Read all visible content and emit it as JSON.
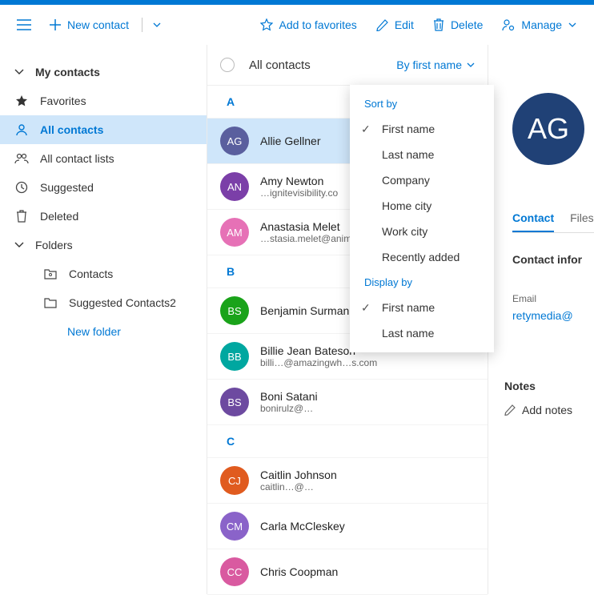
{
  "toolbar": {
    "new_contact": "New contact",
    "add_to_favorites": "Add to favorites",
    "edit": "Edit",
    "delete": "Delete",
    "manage": "Manage"
  },
  "sidebar": {
    "header": "My contacts",
    "items": [
      {
        "label": "Favorites",
        "icon": "star"
      },
      {
        "label": "All contacts",
        "icon": "person",
        "selected": true
      },
      {
        "label": "All contact lists",
        "icon": "group"
      },
      {
        "label": "Suggested",
        "icon": "clock"
      },
      {
        "label": "Deleted",
        "icon": "trash"
      }
    ],
    "folders_label": "Folders",
    "subfolders": [
      {
        "label": "Contacts",
        "icon": "folder-contact"
      },
      {
        "label": "Suggested Contacts2",
        "icon": "folder"
      }
    ],
    "new_folder": "New folder"
  },
  "list": {
    "title": "All contacts",
    "sort_label": "By first name",
    "sections": [
      {
        "letter": "A",
        "contacts": [
          {
            "name": "Allie Gellner",
            "initials": "AG",
            "color": "#5a5f9e",
            "email": "",
            "selected": true
          },
          {
            "name": "Amy Newton",
            "initials": "AN",
            "color": "#7b3fa8",
            "email": "…ignitevisibility.co"
          },
          {
            "name": "Anastasia Melet",
            "initials": "AM",
            "color": "#e671b6",
            "email": "…stasia.melet@anima…"
          }
        ]
      },
      {
        "letter": "B",
        "contacts": [
          {
            "name": "Benjamin Surman",
            "initials": "BS",
            "color": "#1aa31a",
            "email": ""
          },
          {
            "name": "Billie Jean Bateson",
            "initials": "BB",
            "color": "#00a7a0",
            "email": "billi…@amazingwh…s.com"
          },
          {
            "name": "Boni Satani",
            "initials": "BS",
            "color": "#6d4aa0",
            "email": "bonirulz@…"
          }
        ]
      },
      {
        "letter": "C",
        "contacts": [
          {
            "name": "Caitlin Johnson",
            "initials": "CJ",
            "color": "#e05b1f",
            "email": "caitlin…@…"
          },
          {
            "name": "Carla McCleskey",
            "initials": "CM",
            "color": "#8a63c9",
            "email": ""
          },
          {
            "name": "Chris Coopman",
            "initials": "CC",
            "color": "#d95aa0",
            "email": ""
          }
        ]
      }
    ]
  },
  "dropdown": {
    "sort_by": "Sort by",
    "display_by": "Display by",
    "sort_options": [
      "First name",
      "Last name",
      "Company",
      "Home city",
      "Work city",
      "Recently added"
    ],
    "sort_selected": "First name",
    "display_options": [
      "First name",
      "Last name"
    ],
    "display_selected": "First name"
  },
  "detail": {
    "initials": "AG",
    "tab_contact": "Contact",
    "tab_files": "Files",
    "contact_info_label": "Contact infor",
    "email_label": "Email",
    "email_value": "retymedia@",
    "notes_label": "Notes",
    "add_notes": "Add notes"
  }
}
